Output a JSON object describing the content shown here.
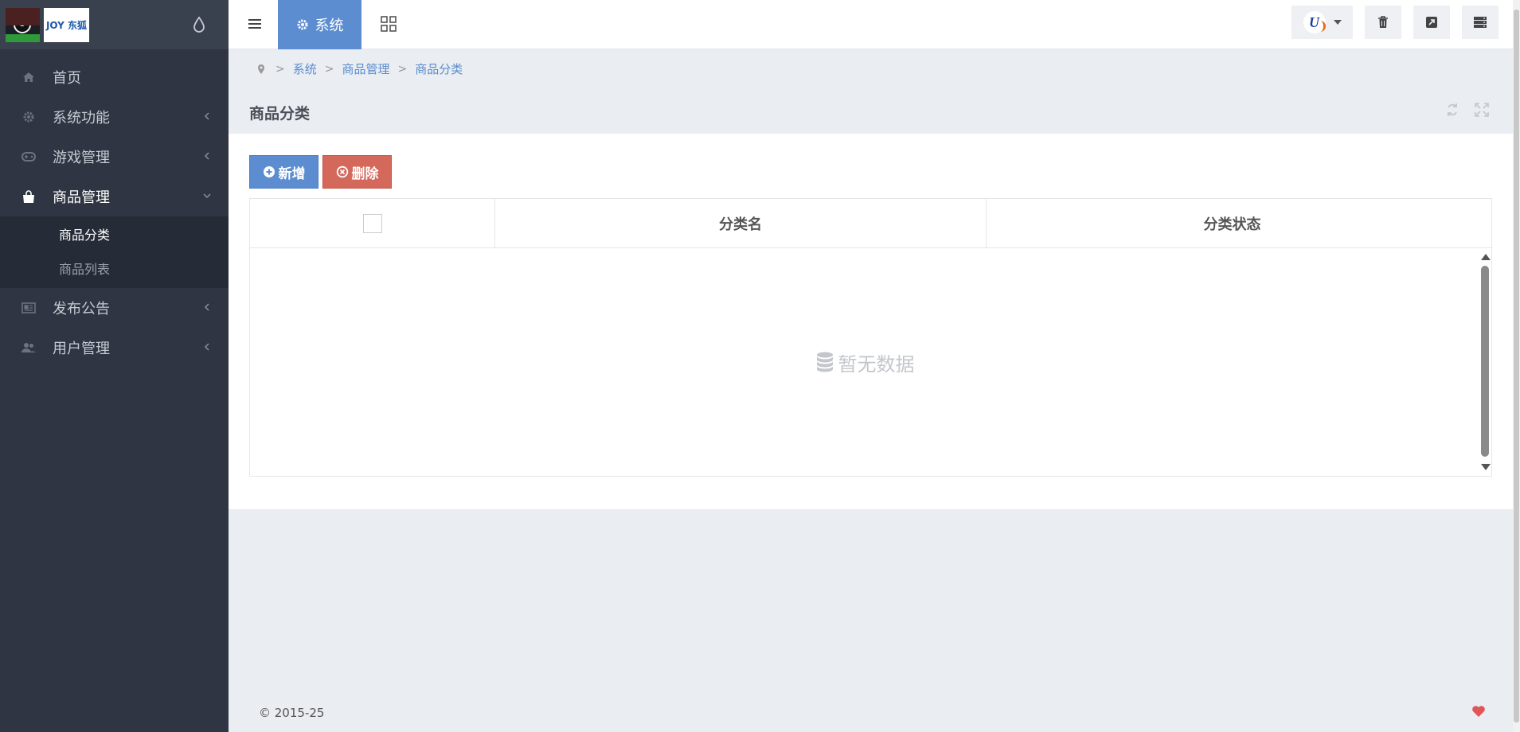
{
  "sidebar": {
    "logo_text": "JOY 东狐",
    "items": [
      {
        "label": "首页",
        "icon": "home-icon"
      },
      {
        "label": "系统功能",
        "icon": "gear-icon"
      },
      {
        "label": "游戏管理",
        "icon": "gamepad-icon"
      },
      {
        "label": "商品管理",
        "icon": "shopping-bag-icon",
        "expanded": true
      },
      {
        "label": "发布公告",
        "icon": "newspaper-icon"
      },
      {
        "label": "用户管理",
        "icon": "users-icon"
      }
    ],
    "submenu": [
      {
        "label": "商品分类",
        "active": true
      },
      {
        "label": "商品列表",
        "active": false
      }
    ]
  },
  "header": {
    "tab_label": "系统"
  },
  "breadcrumb": [
    "系统",
    "商品管理",
    "商品分类"
  ],
  "page": {
    "title": "商品分类"
  },
  "toolbar": {
    "add_label": "新增",
    "delete_label": "删除"
  },
  "table": {
    "columns": [
      "分类名",
      "分类状态"
    ],
    "empty_text": "暂无数据"
  },
  "footer": {
    "copyright": "© 2015-25"
  },
  "colors": {
    "sidebar_bg": "#2f3542",
    "accent": "#5b8dd0",
    "danger": "#d4685b",
    "heart": "#e05555"
  }
}
